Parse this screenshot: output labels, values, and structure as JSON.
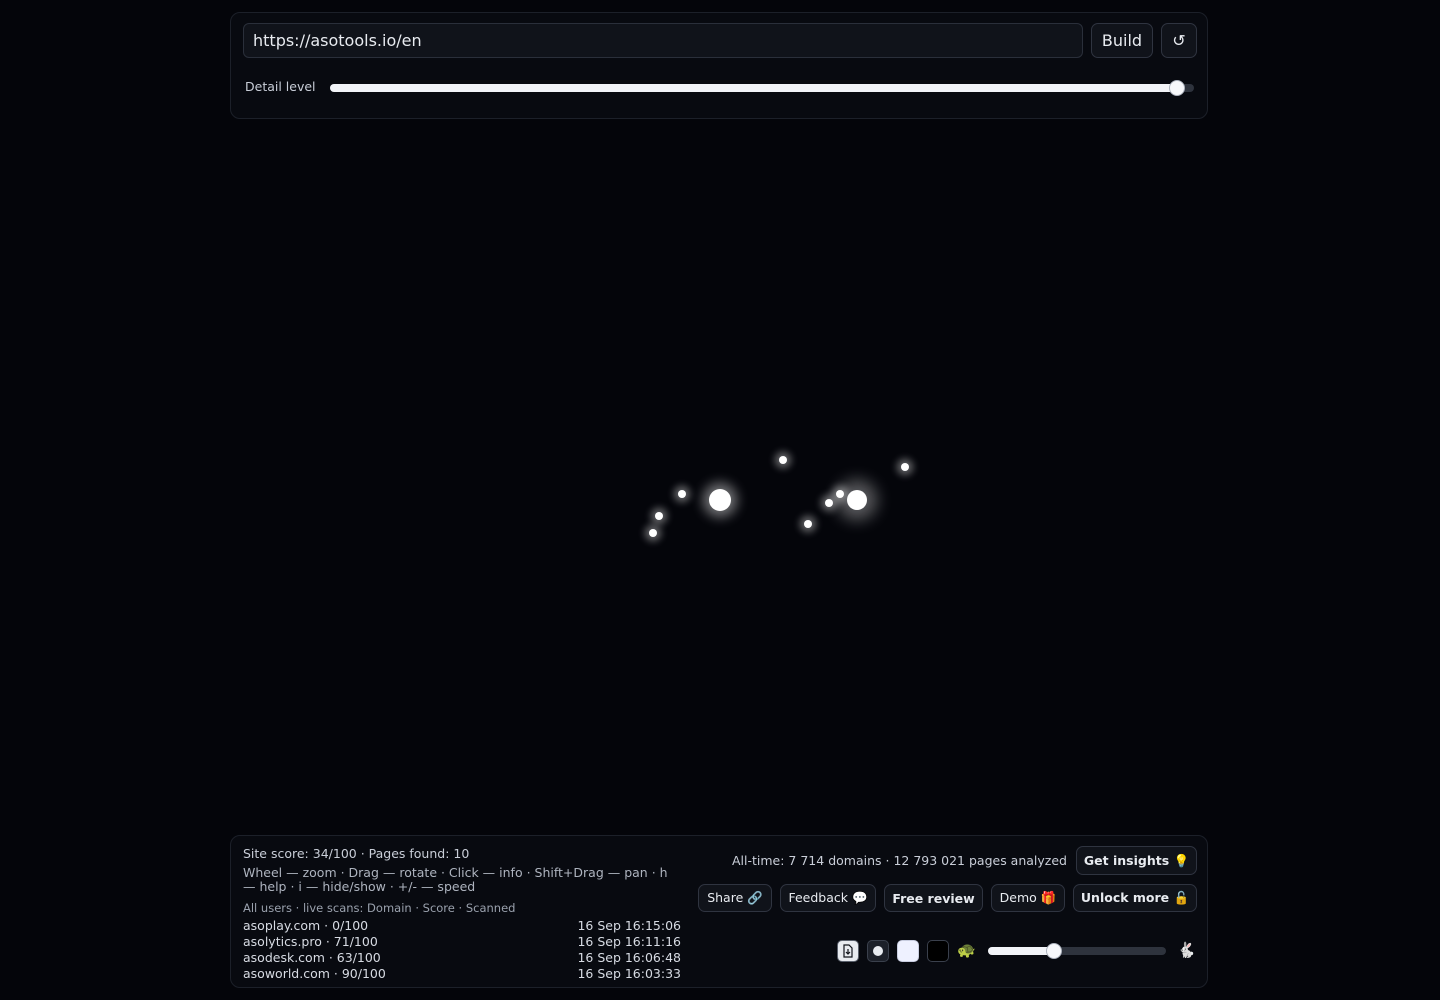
{
  "toolbar": {
    "url_value": "https://asotools.io/en",
    "build_label": "Build",
    "refresh_icon": "↺",
    "detail_label": "Detail level",
    "detail_value": 0.98
  },
  "colors": {
    "background": "#04050a",
    "panel": "#080a10",
    "node": "#ffffff"
  },
  "graph": {
    "node_count": 10
  },
  "footer": {
    "site_stats": "Site score: 34/100 · Pages found: 10",
    "help_text": "Wheel — zoom · Drag — rotate · Click — info · Shift+Drag — pan · h — help · i — hide/show · +/- — speed",
    "scans_header": "All users · live scans: Domain · Score · Scanned",
    "scans": [
      {
        "domain": "asoplay.com · 0/100",
        "time": "16 Sep 16:15:06"
      },
      {
        "domain": "asolytics.pro · 71/100",
        "time": "16 Sep 16:11:16"
      },
      {
        "domain": "asodesk.com · 63/100",
        "time": "16 Sep 16:06:48"
      },
      {
        "domain": "asoworld.com · 90/100",
        "time": "16 Sep 16:03:33"
      }
    ],
    "alltime_stats": "All-time: 7 714 domains · 12 793 021 pages analyzed",
    "insights_label": "Get insights 💡",
    "share_label": "Share 🔗",
    "feedback_label": "Feedback 💬",
    "review_label": "Free review",
    "demo_label": "Demo 🎁",
    "unlock_label": "Unlock more 🔓",
    "export_icon": "download-icon",
    "turtle": "🐢",
    "rabbit": "🐇",
    "speed_value": 0.37
  }
}
